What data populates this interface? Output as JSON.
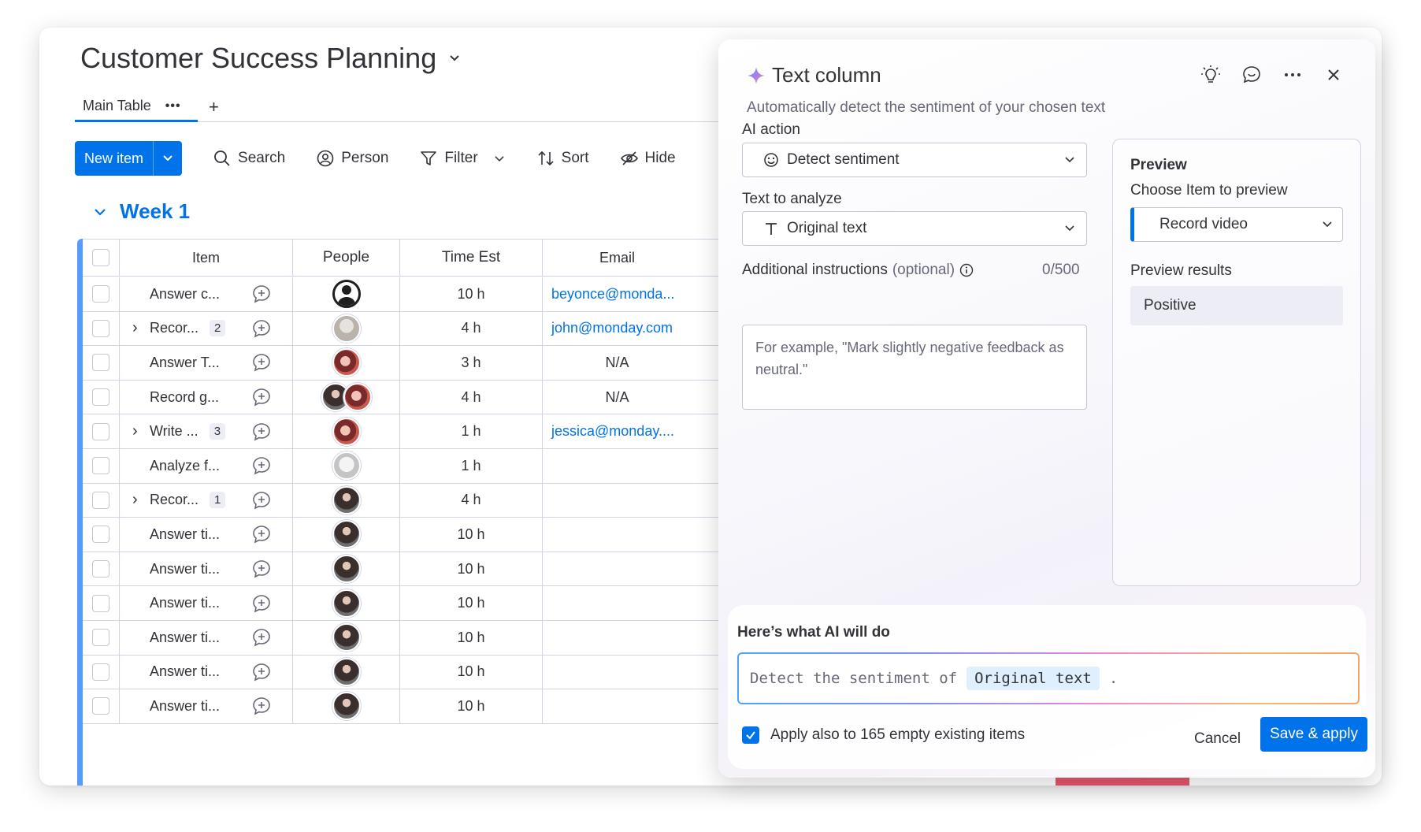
{
  "board": {
    "title": "Customer Success Planning",
    "tab_main": "Main Table",
    "tab_dots": "•••",
    "tab_add": "+"
  },
  "toolbar": {
    "new_item": "New item",
    "search": "Search",
    "person": "Person",
    "filter": "Filter",
    "sort": "Sort",
    "hide": "Hide"
  },
  "group": {
    "title": "Week 1"
  },
  "table": {
    "headers": {
      "item": "Item",
      "people": "People",
      "time": "Time Est",
      "email": "Email"
    },
    "rows": [
      {
        "item": "Answer c...",
        "count": "",
        "time": "10 h",
        "email": "beyonce@monda...",
        "avatar": "default"
      },
      {
        "item": "Recor...",
        "count": "2",
        "time": "4 h",
        "email": "john@monday.com",
        "avatar": "grey"
      },
      {
        "item": "Answer T...",
        "count": "",
        "time": "3 h",
        "email": "N/A",
        "avatar": "warm"
      },
      {
        "item": "Record g...",
        "count": "",
        "time": "4 h",
        "email": "N/A",
        "avatar": "pair"
      },
      {
        "item": "Write ...",
        "count": "3",
        "time": "1 h",
        "email": "jessica@monday....",
        "avatar": "warm"
      },
      {
        "item": "Analyze f...",
        "count": "",
        "time": "1 h",
        "email": "",
        "avatar": "light"
      },
      {
        "item": "Recor...",
        "count": "1",
        "time": "4 h",
        "email": "",
        "avatar": "dark"
      },
      {
        "item": "Answer ti...",
        "count": "",
        "time": "10 h",
        "email": "",
        "avatar": "dark"
      },
      {
        "item": "Answer ti...",
        "count": "",
        "time": "10 h",
        "email": "",
        "avatar": "dark"
      },
      {
        "item": "Answer ti...",
        "count": "",
        "time": "10 h",
        "email": "",
        "avatar": "dark"
      },
      {
        "item": "Answer ti...",
        "count": "",
        "time": "10 h",
        "email": "",
        "avatar": "dark"
      },
      {
        "item": "Answer ti...",
        "count": "",
        "time": "10 h",
        "email": "",
        "avatar": "dark"
      },
      {
        "item": "Answer ti...",
        "count": "",
        "time": "10 h",
        "email": "",
        "avatar": "dark"
      }
    ]
  },
  "panel": {
    "title": "Text column",
    "subtitle": "Automatically detect the sentiment of your chosen text",
    "ai_action_label": "AI action",
    "ai_action_value": "Detect sentiment",
    "text_label": "Text to analyze",
    "text_value": "Original text",
    "instructions_label": "Additional instructions",
    "instructions_optional": "(optional)",
    "instructions_counter": "0/500",
    "instructions_placeholder": "For example, \"Mark slightly negative feedback as neutral.\"",
    "preview": {
      "title": "Preview",
      "choose_label": "Choose Item to preview",
      "choose_value": "Record video",
      "results_label": "Preview results",
      "results_value": "Positive"
    },
    "ai_summary": {
      "title": "Here’s what AI will do",
      "prefix": "Detect the sentiment of",
      "token": "Original text",
      "suffix": "."
    },
    "apply_label": "Apply also to 165 empty existing items",
    "cancel": "Cancel",
    "save": "Save & apply"
  },
  "colors": {
    "accent": "#0073ea",
    "group": "#579bfc"
  }
}
